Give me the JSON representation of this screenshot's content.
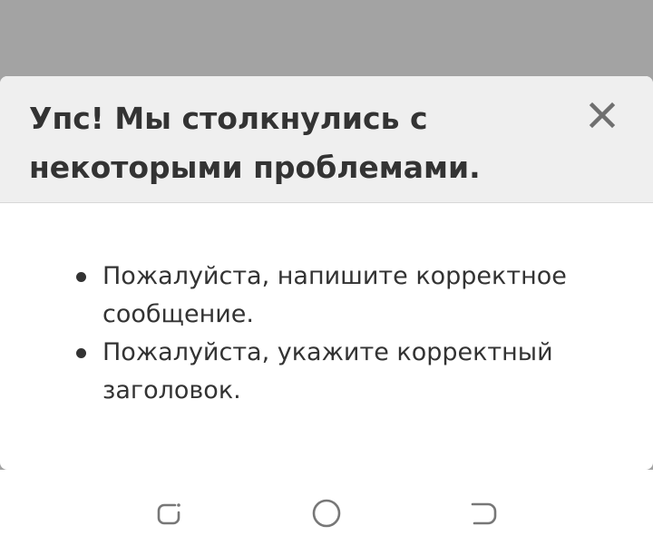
{
  "dialog": {
    "title": "Упс! Мы столкнулись с некоторыми проблемами.",
    "close_icon": "close-icon",
    "errors": [
      "Пожалуйста, напишите корректное сообщение.",
      "Пожалуйста, укажите корректный заголовок."
    ]
  },
  "navbar": {
    "icons": [
      "recent-apps-icon",
      "home-icon",
      "back-icon"
    ]
  },
  "colors": {
    "overlay": "#a3a3a3",
    "header_bg": "#efefef",
    "text": "#333333",
    "icon": "#777777"
  }
}
